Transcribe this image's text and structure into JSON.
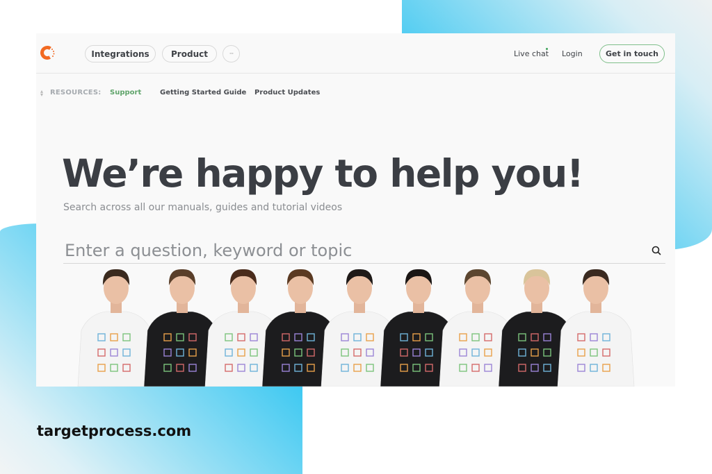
{
  "background": {
    "accent_color": "#0fbdf2",
    "fade_color": "#eef1f2"
  },
  "header": {
    "logo_color": "#f26a22",
    "nav_buttons": [
      {
        "label": "Integrations"
      },
      {
        "label": "Product"
      },
      {
        "label": "···",
        "icon": "more-icon"
      }
    ],
    "live_chat_label": "Live chat",
    "live_chat_status_color": "#3fa45b",
    "login_label": "Login",
    "cta_label": "Get in touch",
    "cta_border_color": "#7fbf8a"
  },
  "resources": {
    "label": "RESOURCES:",
    "links": [
      {
        "label": "Support",
        "active": true,
        "color": "#5fa46a"
      },
      {
        "label": "Getting Started Guide"
      },
      {
        "label": "Product Updates"
      }
    ]
  },
  "hero": {
    "title": "We’re happy to help you!",
    "subtitle": "Search across all our manuals, guides and tutorial videos"
  },
  "search": {
    "value": "",
    "placeholder": "Enter a question, keyword or topic",
    "icon": "search-icon"
  },
  "team_photo": {
    "alt": "Team members in white and black t-shirts",
    "people": [
      {
        "shirt": "white"
      },
      {
        "shirt": "black"
      },
      {
        "shirt": "white"
      },
      {
        "shirt": "black"
      },
      {
        "shirt": "white"
      },
      {
        "shirt": "black"
      },
      {
        "shirt": "white"
      },
      {
        "shirt": "black"
      },
      {
        "shirt": "white"
      }
    ]
  },
  "footer": {
    "site_label": "targetprocess.com"
  }
}
